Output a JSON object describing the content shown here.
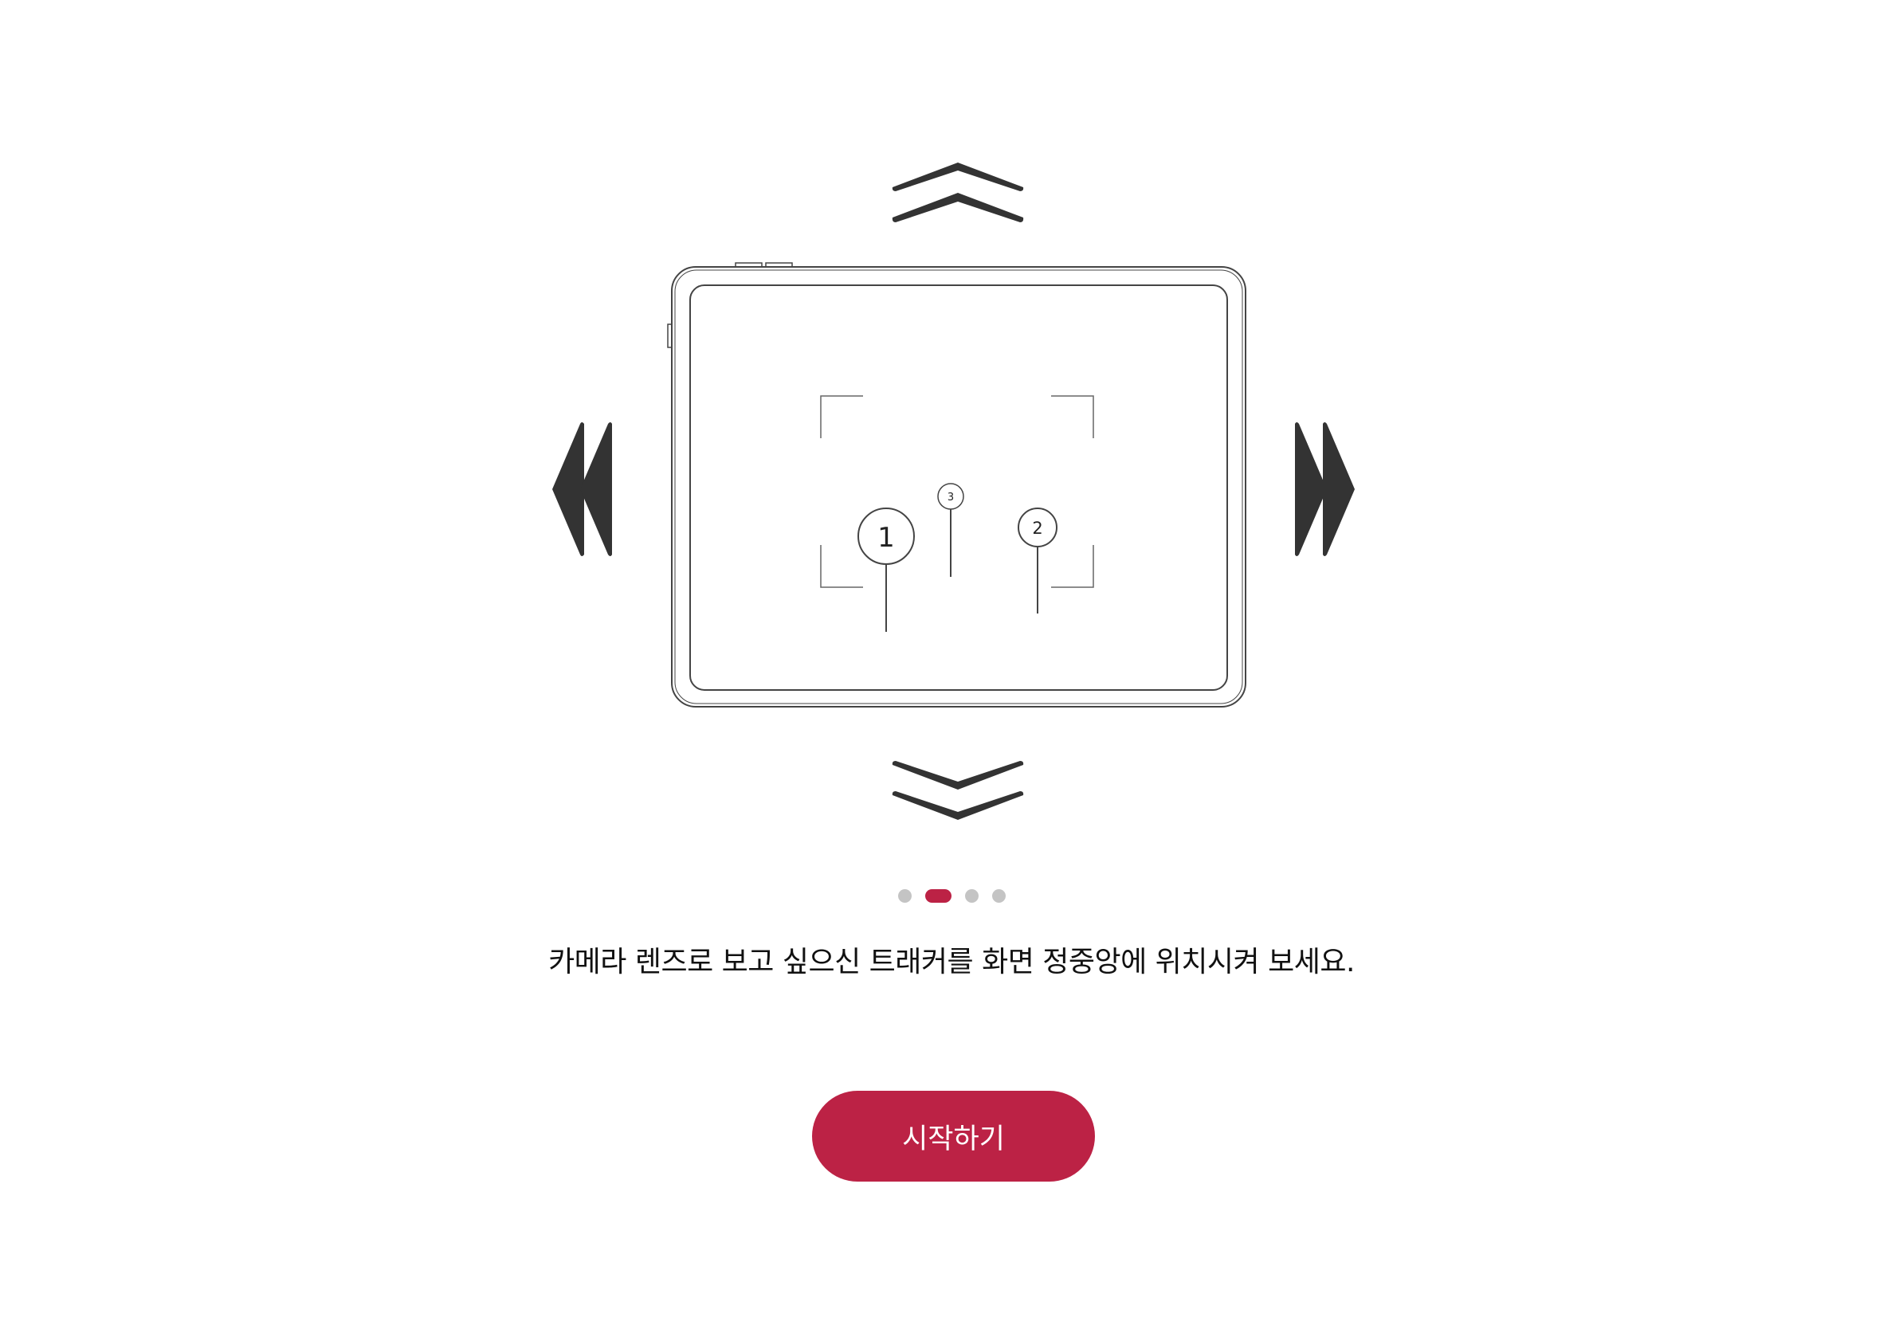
{
  "illustration": {
    "tablet_icon": "tablet-outline-icon",
    "arrow_icons": [
      "double-chevron-up-icon",
      "double-chevron-down-icon",
      "double-chevron-left-icon",
      "double-chevron-right-icon"
    ],
    "viewfinder_icon": "viewfinder-corners-icon",
    "markers": [
      {
        "label": "1",
        "icon": "map-pin-icon"
      },
      {
        "label": "2",
        "icon": "map-pin-icon"
      },
      {
        "label": "3",
        "icon": "map-pin-icon"
      }
    ]
  },
  "pager": {
    "total": 4,
    "current": 2
  },
  "instruction": "카메라 렌즈로 보고 싶으신 트래커를 화면 정중앙에 위치시켜 보세요.",
  "start_button": {
    "label": "시작하기"
  },
  "colors": {
    "accent": "#BC2245",
    "arrow": "#333333",
    "dot_inactive": "#C4C4C4",
    "line": "#444444",
    "text": "#111111"
  }
}
